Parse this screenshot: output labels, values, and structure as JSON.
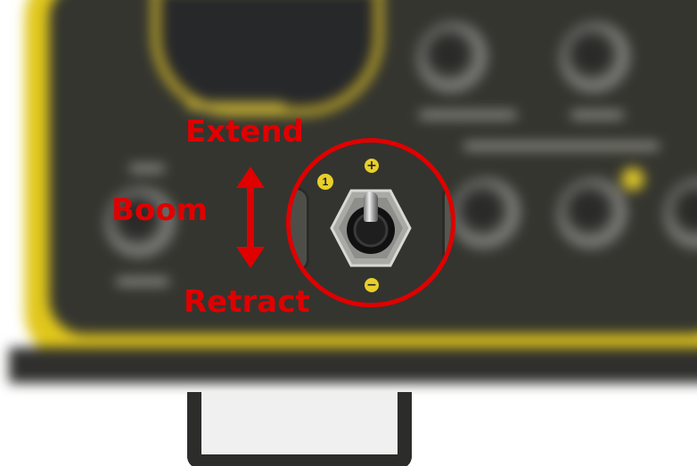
{
  "annotation": {
    "extend_label": "Extend",
    "boom_label": "Boom",
    "retract_label": "Retract"
  },
  "inset": {
    "switch_number": "1",
    "plus_symbol": "+",
    "minus_symbol": "−"
  },
  "colors": {
    "annotation_red": "#e00000",
    "housing_yellow": "#e1c71b",
    "panel_dark": "#34352f"
  },
  "icons": {
    "arrow": "double-headed-vertical-arrow-icon",
    "toggle": "toggle-switch-icon"
  }
}
